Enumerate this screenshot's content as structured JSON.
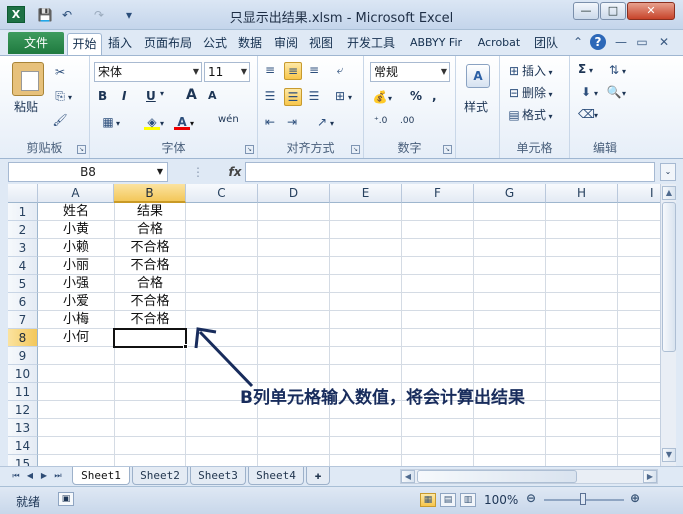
{
  "window": {
    "title": "只显示出结果.xlsm - Microsoft Excel",
    "app_icon": "X",
    "controls": {
      "minimize": "—",
      "maximize": "□",
      "close": "✕"
    }
  },
  "qat": {
    "save": "💾",
    "undo": "↶",
    "redo": "↷",
    "customize": "▾"
  },
  "ribbon_tabs": {
    "file": "文件",
    "items": [
      "开始",
      "插入",
      "页面布局",
      "公式",
      "数据",
      "审阅",
      "视图",
      "开发工具",
      "ABBYY Fir",
      "Acrobat",
      "团队"
    ],
    "active": "开始"
  },
  "ribbon": {
    "clipboard": {
      "label": "剪贴板",
      "paste": "粘贴"
    },
    "font": {
      "label": "字体",
      "font_name": "宋体",
      "font_size": "11",
      "bold": "B",
      "italic": "I",
      "underline": "U",
      "grow": "A",
      "shrink": "A",
      "phonetic": "wén"
    },
    "alignment": {
      "label": "对齐方式"
    },
    "number": {
      "label": "数字",
      "format": "常规"
    },
    "styles": {
      "label": "样式"
    },
    "cells": {
      "label": "单元格",
      "insert": "插入",
      "delete": "删除",
      "format": "格式"
    },
    "editing": {
      "label": "编辑"
    }
  },
  "formula_bar": {
    "name_box": "B8",
    "fx": "fx",
    "content": ""
  },
  "columns": [
    "A",
    "B",
    "C",
    "D",
    "E",
    "F",
    "G",
    "H",
    "I"
  ],
  "active_column": "B",
  "rows": [
    "1",
    "2",
    "3",
    "4",
    "5",
    "6",
    "7",
    "8",
    "9",
    "10",
    "11",
    "12",
    "13",
    "14",
    "15"
  ],
  "active_row": "8",
  "cells": [
    {
      "a": "姓名",
      "b": "结果"
    },
    {
      "a": "小黄",
      "b": "合格"
    },
    {
      "a": "小赖",
      "b": "不合格"
    },
    {
      "a": "小丽",
      "b": "不合格"
    },
    {
      "a": "小强",
      "b": "合格"
    },
    {
      "a": "小爱",
      "b": "不合格"
    },
    {
      "a": "小梅",
      "b": "不合格"
    },
    {
      "a": "小何",
      "b": ""
    }
  ],
  "annotation": "B列单元格输入数值，将会计算出结果",
  "sheet_tabs": [
    "Sheet1",
    "Sheet2",
    "Sheet3",
    "Sheet4"
  ],
  "active_sheet": "Sheet1",
  "status": {
    "mode": "就绪",
    "zoom": "100%"
  }
}
